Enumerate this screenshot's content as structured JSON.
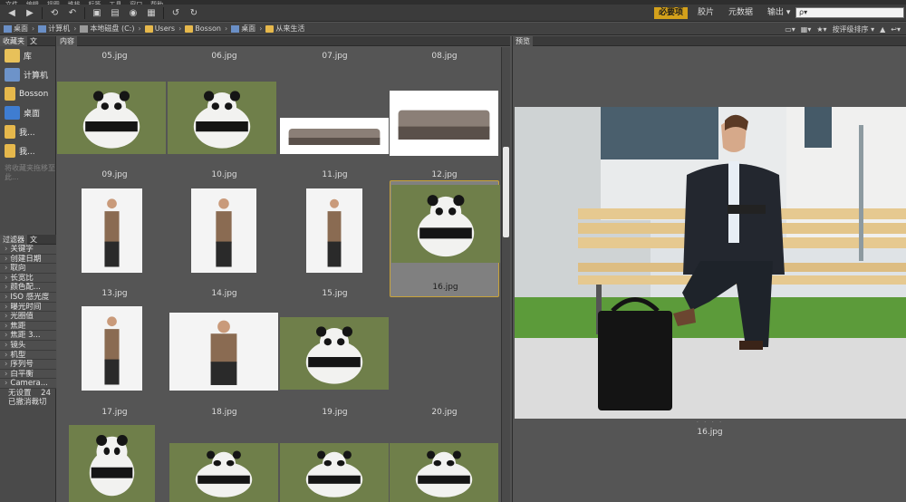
{
  "menubar": {
    "items": [
      "文件",
      "编辑",
      "视图",
      "堆栈",
      "标签",
      "工具",
      "窗口",
      "帮助"
    ]
  },
  "toolbar": {
    "workspaces": [
      {
        "label": "必要项",
        "active": true
      },
      {
        "label": "胶片",
        "active": false
      },
      {
        "label": "元数据",
        "active": false
      },
      {
        "label": "输出 ▾",
        "active": false
      }
    ],
    "search_placeholder": "ρ▾"
  },
  "path": {
    "crumbs": [
      {
        "label": "桌面",
        "icon": "desktop-icon"
      },
      {
        "label": "计算机",
        "icon": "computer-icon"
      },
      {
        "label": "本地磁盘 (C:)",
        "icon": "drive-icon"
      },
      {
        "label": "Users",
        "icon": "folder-icon"
      },
      {
        "label": "Bosson",
        "icon": "folder-icon"
      },
      {
        "label": "桌面",
        "icon": "desktop-icon"
      },
      {
        "label": "从来生活",
        "icon": "folder-icon"
      }
    ],
    "sort_label": "按评级排序 ▾"
  },
  "favorites": {
    "tabs": [
      "收藏夹",
      "文"
    ],
    "items": [
      {
        "label": "库",
        "icon": "library-icon",
        "color": "#e8c15a"
      },
      {
        "label": "计算机",
        "icon": "computer-icon",
        "color": "#6d93c9"
      },
      {
        "label": "Bosson",
        "icon": "user-folder-icon",
        "color": "#e6b84c"
      },
      {
        "label": "桌面",
        "icon": "desktop-icon",
        "color": "#3f7dd1"
      },
      {
        "label": "我...",
        "icon": "documents-icon",
        "color": "#e6b84c"
      },
      {
        "label": "我...",
        "icon": "pictures-icon",
        "color": "#e6b84c"
      }
    ],
    "hint": "将收藏夹拖移至此..."
  },
  "filter": {
    "tabs": [
      "过滤器",
      "文"
    ],
    "items": [
      "关键字",
      "创建日期",
      "取向",
      "长宽比",
      "颜色配...",
      "ISO 感光度",
      "曝光时间",
      "光圈值",
      "焦距",
      "焦距 3...",
      "镜头",
      "机型",
      "序列号",
      "白平衡",
      "Camera..."
    ],
    "unset_label": "无设置",
    "unset_count": "24",
    "cancel_label": "已撤消裁切"
  },
  "content": {
    "tab_label": "内容",
    "thumbnails": [
      {
        "name": "05.jpg",
        "subject": "panda"
      },
      {
        "name": "06.jpg",
        "subject": "panda"
      },
      {
        "name": "07.jpg",
        "subject": "sofa"
      },
      {
        "name": "08.jpg",
        "subject": "sofa"
      },
      {
        "name": "09.jpg",
        "subject": "person"
      },
      {
        "name": "10.jpg",
        "subject": "person"
      },
      {
        "name": "11.jpg",
        "subject": "person"
      },
      {
        "name": "12.jpg",
        "subject": "businessman"
      },
      {
        "name": "13.jpg",
        "subject": "person"
      },
      {
        "name": "14.jpg",
        "subject": "person"
      },
      {
        "name": "15.jpg",
        "subject": "panda"
      },
      {
        "name": "16.jpg",
        "subject": "panda"
      },
      {
        "name": "17.jpg",
        "subject": "panda"
      },
      {
        "name": "18.jpg",
        "subject": "panda"
      },
      {
        "name": "19.jpg",
        "subject": "panda"
      },
      {
        "name": "20.jpg",
        "subject": "panda"
      }
    ],
    "selected_label": "16.jpg"
  },
  "preview": {
    "tab_label": "预览",
    "caption": "16.jpg",
    "dots": "· · · ·"
  }
}
